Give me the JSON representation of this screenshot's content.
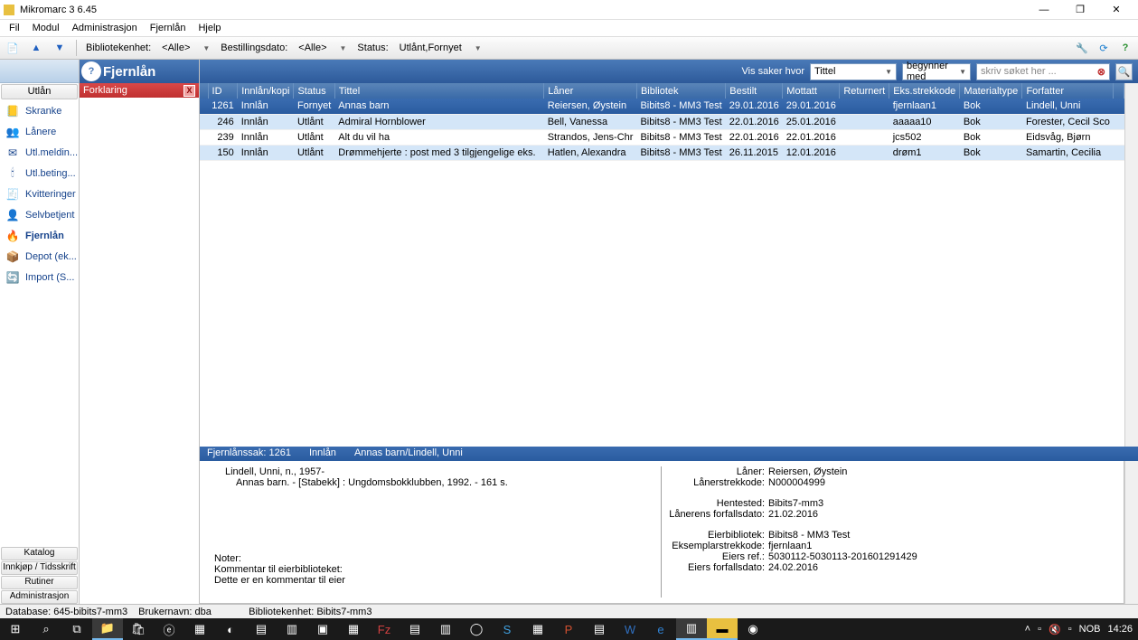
{
  "title": "Mikromarc 3 6.45",
  "menu": [
    "Fil",
    "Modul",
    "Administrasjon",
    "Fjernlån",
    "Hjelp"
  ],
  "toolbar": {
    "unit_label": "Bibliotekenhet:",
    "unit_value": "<Alle>",
    "order_label": "Bestillingsdato:",
    "order_value": "<Alle>",
    "status_label": "Status:",
    "status_value": "Utlånt,Fornyet"
  },
  "leftpanel": {
    "category": "Utlån",
    "items": [
      {
        "icon": "📒",
        "label": "Skranke"
      },
      {
        "icon": "👥",
        "label": "Lånere"
      },
      {
        "icon": "✉",
        "label": "Utl.meldin..."
      },
      {
        "icon": "🕯",
        "label": "Utl.beting..."
      },
      {
        "icon": "🧾",
        "label": "Kvitteringer"
      },
      {
        "icon": "👤",
        "label": "Selvbetjent"
      },
      {
        "icon": "🔥",
        "label": "Fjernlån"
      },
      {
        "icon": "📦",
        "label": "Depot (ek..."
      },
      {
        "icon": "🔄",
        "label": "Import (S..."
      }
    ],
    "bottom": [
      "Katalog",
      "Innkjøp / Tidsskrift",
      "Rutiner",
      "Administrasjon"
    ]
  },
  "midpanel": {
    "header": "Fjernlån",
    "sub": "Forklaring"
  },
  "mainheader": {
    "vis": "Vis saker hvor",
    "field": "Tittel",
    "op": "begynner med",
    "placeholder": "skriv søket her ..."
  },
  "columns": [
    "ID",
    "Innlån/kopi",
    "Status",
    "Tittel",
    "Låner",
    "Bibliotek",
    "Bestilt",
    "Mottatt",
    "Returnert",
    "Eks.strekkode",
    "Materialtype",
    "Forfatter"
  ],
  "rows": [
    {
      "id": "1261",
      "ik": "Innlån",
      "st": "Fornyet",
      "ti": "Annas barn",
      "la": "Reiersen, Øystein",
      "bi": "Bibits8 - MM3 Test",
      "be": "29.01.2016",
      "mo": "29.01.2016",
      "re": "",
      "ek": "fjernlaan1",
      "ma": "Bok",
      "fo": "Lindell, Unni",
      "sel": true
    },
    {
      "id": "246",
      "ik": "Innlån",
      "st": "Utlånt",
      "ti": "Admiral Hornblower",
      "la": "Bell, Vanessa",
      "bi": "Bibits8 - MM3 Test",
      "be": "22.01.2016",
      "mo": "25.01.2016",
      "re": "",
      "ek": "aaaaa10",
      "ma": "Bok",
      "fo": "Forester, Cecil Sco",
      "alt": true
    },
    {
      "id": "239",
      "ik": "Innlån",
      "st": "Utlånt",
      "ti": "Alt du vil ha",
      "la": "Strandos, Jens-Chr",
      "bi": "Bibits8 - MM3 Test",
      "be": "22.01.2016",
      "mo": "22.01.2016",
      "re": "",
      "ek": "jcs502",
      "ma": "Bok",
      "fo": "Eidsvåg, Bjørn"
    },
    {
      "id": "150",
      "ik": "Innlån",
      "st": "Utlånt",
      "ti": "Drømmehjerte : post med 3 tilgjengelige eks.",
      "la": "Hatlen, Alexandra",
      "bi": "Bibits8 - MM3 Test",
      "be": "26.11.2015",
      "mo": "12.01.2016",
      "re": "",
      "ek": "drøm1",
      "ma": "Bok",
      "fo": "Samartin, Cecilia",
      "alt": true
    }
  ],
  "detail": {
    "header": {
      "sak": "Fjernlånssak: 1261",
      "type": "Innlån",
      "title": "Annas barn/Lindell, Unni"
    },
    "left": {
      "line1": "Lindell, Unni, n., 1957-",
      "line2": "Annas barn. - [Stabekk] : Ungdomsbokklubben, 1992. - 161 s.",
      "noter_label": "Noter:",
      "komm_label": "Kommentar til eierbiblioteket:",
      "komm_value": "Dette er en kommentar til eier"
    },
    "right": [
      {
        "l": "Låner:",
        "v": "Reiersen, Øystein"
      },
      {
        "l": "Lånerstrekkode:",
        "v": "N000004999"
      },
      {
        "l": "",
        "v": ""
      },
      {
        "l": "Hentested:",
        "v": "Bibits7-mm3"
      },
      {
        "l": "Lånerens forfallsdato:",
        "v": "21.02.2016"
      },
      {
        "l": "",
        "v": ""
      },
      {
        "l": "Eierbibliotek:",
        "v": "Bibits8 - MM3 Test"
      },
      {
        "l": "Eksemplarstrekkode:",
        "v": "fjernlaan1"
      },
      {
        "l": "Eiers ref.:",
        "v": "5030112-5030113-201601291429"
      },
      {
        "l": "Eiers forfallsdato:",
        "v": "24.02.2016"
      }
    ]
  },
  "statusbar": {
    "db": "Database: 645-bibits7-mm3",
    "user": "Brukernavn: dba",
    "unit": "Bibliotekenhet: Bibits7-mm3"
  },
  "taskbar": {
    "lang": "NOB",
    "time": "14:26"
  }
}
